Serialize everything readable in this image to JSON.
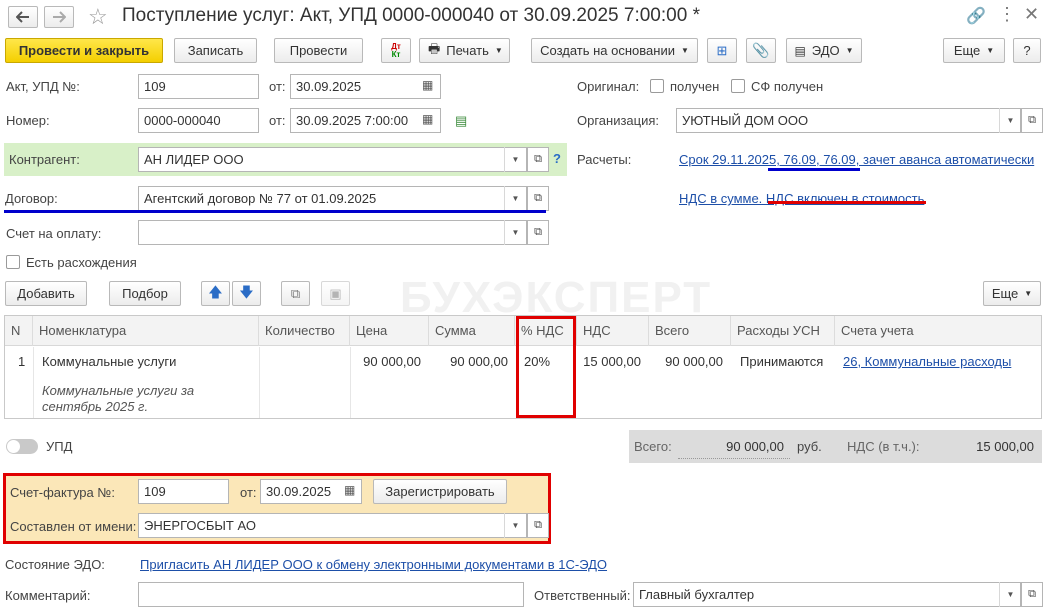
{
  "window": {
    "title": "Поступление услуг: Акт, УПД 0000-000040 от 30.09.2025 7:00:00 *"
  },
  "toolbar": {
    "post_and_close": "Провести и закрыть",
    "save": "Записать",
    "post": "Провести",
    "dtkt": "Дт Кт",
    "print": "Печать",
    "create_based_on": "Создать на основании",
    "edo": "ЭДО",
    "more": "Еще",
    "help": "?"
  },
  "header": {
    "act_label": "Акт, УПД №:",
    "act_number": "109",
    "from_label": "от:",
    "act_date": "30.09.2025",
    "number_label": "Номер:",
    "number_value": "0000-000040",
    "number_date": "30.09.2025  7:00:00",
    "contractor_label": "Контрагент:",
    "contractor_value": "АН ЛИДЕР ООО",
    "contract_label": "Договор:",
    "contract_value": "Агентский договор № 77 от 01.09.2025",
    "invoice_label": "Счет на оплату:",
    "invoice_value": "",
    "discrepancy_label": "Есть расхождения",
    "original_label": "Оригинал:",
    "received_label": "получен",
    "sf_received_label": "СФ получен",
    "org_label": "Организация:",
    "org_value": "УЮТНЫЙ ДОМ ООО",
    "settlements_label": "Расчеты:",
    "settlements_link": "Срок 29.11.2025, 76.09, 76.09, зачет аванса автоматически",
    "vat_link": "НДС в сумме. НДС включен в стоимость",
    "help_q": "?"
  },
  "table_toolbar": {
    "add": "Добавить",
    "select": "Подбор",
    "more": "Еще"
  },
  "watermark": "БУХЭКСПЕРТ",
  "table": {
    "columns": [
      "N",
      "Номенклатура",
      "Количество",
      "Цена",
      "Сумма",
      "% НДС",
      "НДС",
      "Всего",
      "Расходы УСН",
      "Счета учета"
    ],
    "rows": [
      {
        "n": "1",
        "item": "Коммунальные услуги",
        "item_note": "Коммунальные услуги за сентябрь 2025 г.",
        "qty": "",
        "price": "90 000,00",
        "sum": "90 000,00",
        "vat_rate": "20%",
        "vat": "15 000,00",
        "total": "90 000,00",
        "usn": "Принимаются",
        "accounts": "26, Коммунальные расходы"
      }
    ]
  },
  "totals": {
    "upd_label": "УПД",
    "total_label": "Всего:",
    "total_value": "90 000,00",
    "currency": "руб.",
    "vat_label": "НДС (в т.ч.):",
    "vat_value": "15 000,00"
  },
  "sf": {
    "label": "Счет-фактура №:",
    "number": "109",
    "from_label": "от:",
    "date": "30.09.2025",
    "register_btn": "Зарегистрировать",
    "on_behalf_label": "Составлен от имени:",
    "on_behalf_value": "ЭНЕРГОСБЫТ АО"
  },
  "footer": {
    "edo_state_label": "Состояние ЭДО:",
    "edo_link": "Пригласить АН ЛИДЕР ООО к обмену электронными документами в 1С-ЭДО",
    "comment_label": "Комментарий:",
    "comment_value": "",
    "responsible_label": "Ответственный:",
    "responsible_value": "Главный бухгалтер"
  },
  "colors": {
    "accent_yellow": "#f4cf00",
    "highlight_red": "#e00000",
    "underline_blue": "#0000cc",
    "link": "#1d4fa8",
    "green_row": "#d8f0c8",
    "sf_bg": "#fbe7b8"
  }
}
